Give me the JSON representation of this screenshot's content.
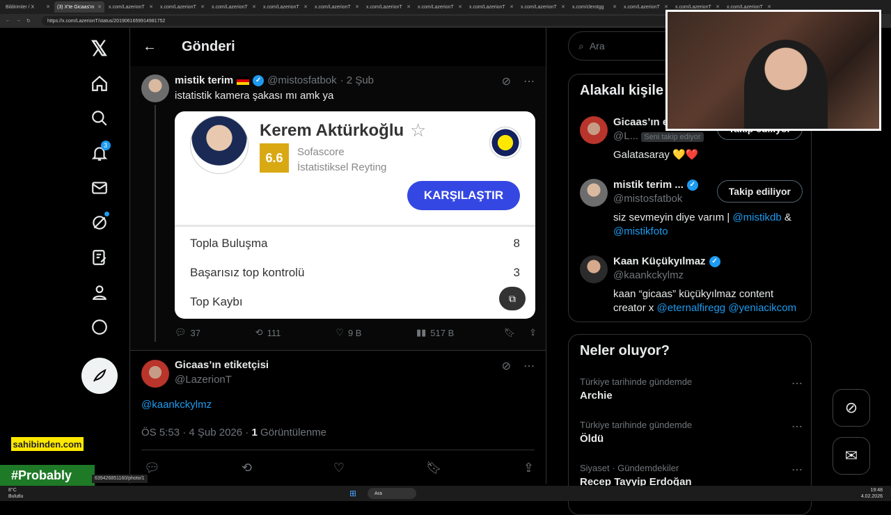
{
  "browser": {
    "tabs": [
      {
        "label": "Bildirimler / X",
        "active": false
      },
      {
        "label": "(3) X'te Gicaas'ın",
        "active": true
      },
      {
        "label": "x.com/LazerionT",
        "active": false
      },
      {
        "label": "x.com/LazerionT",
        "active": false
      },
      {
        "label": "x.com/LazerionT",
        "active": false
      },
      {
        "label": "x.com/LazerionT",
        "active": false
      },
      {
        "label": "x.com/LazerionT",
        "active": false
      },
      {
        "label": "x.com/LazerionT",
        "active": false
      },
      {
        "label": "x.com/LazerionT",
        "active": false
      },
      {
        "label": "x.com/LazerionT",
        "active": false
      },
      {
        "label": "x.com/LazerionT",
        "active": false
      },
      {
        "label": "x.com/clerotgg",
        "active": false
      },
      {
        "label": "x.com/LazerionT",
        "active": false
      },
      {
        "label": "x.com/LazerionT",
        "active": false
      },
      {
        "label": "x.com/LazerionT",
        "active": false
      }
    ],
    "url": "https://x.com/LazerionT/status/2019061659914981752"
  },
  "nav": {
    "notification_count": "3"
  },
  "header": {
    "title": "Gönderi"
  },
  "tweet": {
    "author": "mistik terim",
    "handle": "@mistosfatbok",
    "date": "· 2 Şub",
    "text": "istatistik kamera şakası mı amk ya",
    "card": {
      "player_name": "Kerem Aktürkoğlu",
      "rating": "6.6",
      "rating_source_line1": "Sofascore",
      "rating_source_line2": "İstatistiksel Reyting",
      "compare_label": "KARŞILAŞTIR",
      "stats": [
        {
          "label": "Topla Buluşma",
          "value": "8"
        },
        {
          "label": "Başarısız top kontrolü",
          "value": "3"
        },
        {
          "label": "Top Kaybı",
          "value": ""
        }
      ]
    },
    "metrics": {
      "replies": "37",
      "reposts": "111",
      "likes": "9 B",
      "views": "517 B"
    }
  },
  "reply": {
    "author": "Gicaas’ın etiketçisi",
    "handle": "@LazerionT",
    "mention": "@kaankckylmz",
    "time": "ÖS 5:53 · 4 Şub 2026 · ",
    "views_count": "1",
    "views_label": " Görüntülenme"
  },
  "sidebar": {
    "search_placeholder": "Ara",
    "related_title": "Alakalı kişile",
    "people": [
      {
        "name": "Gicaas’ın e",
        "handle": "@L...",
        "follows_you": "Seni takip ediyor",
        "button": "Takip ediliyor",
        "bio": "Galatasaray 💛❤️"
      },
      {
        "name": "mistik terim ...",
        "handle": "@mistosfatbok",
        "button": "Takip ediliyor",
        "bio_prefix": "siz sevmeyin diye varım | ",
        "bio_link1": "@mistikdb",
        "bio_mid": " & ",
        "bio_link2": "@mistikfoto"
      },
      {
        "name": "Kaan Küçükyılmaz",
        "handle": "@kaankckylmz",
        "bio_prefix": "kaan “gicaas” küçükyılmaz content creator x ",
        "bio_link1": "@eternalfiregg",
        "bio_link2": "@yeniacikcom"
      }
    ],
    "trends_title": "Neler oluyor?",
    "trends": [
      {
        "meta": "Türkiye tarihinde gündemde",
        "name": "Archie"
      },
      {
        "meta": "Türkiye tarihinde gündemde",
        "name": "Öldü"
      },
      {
        "meta": "Siyaset · Gündemdekiler",
        "name": "Recep Tayyip Erdoğan"
      }
    ]
  },
  "overlay": {
    "sahibinden": "sahibinden.com",
    "probably": "#Probably",
    "status_url": "639426851160/photo/1"
  },
  "taskbar": {
    "weather_temp": "8°C",
    "weather_text": "Bulutlu",
    "search": "Ara",
    "time": "19:48",
    "date": "4.02.2026"
  }
}
